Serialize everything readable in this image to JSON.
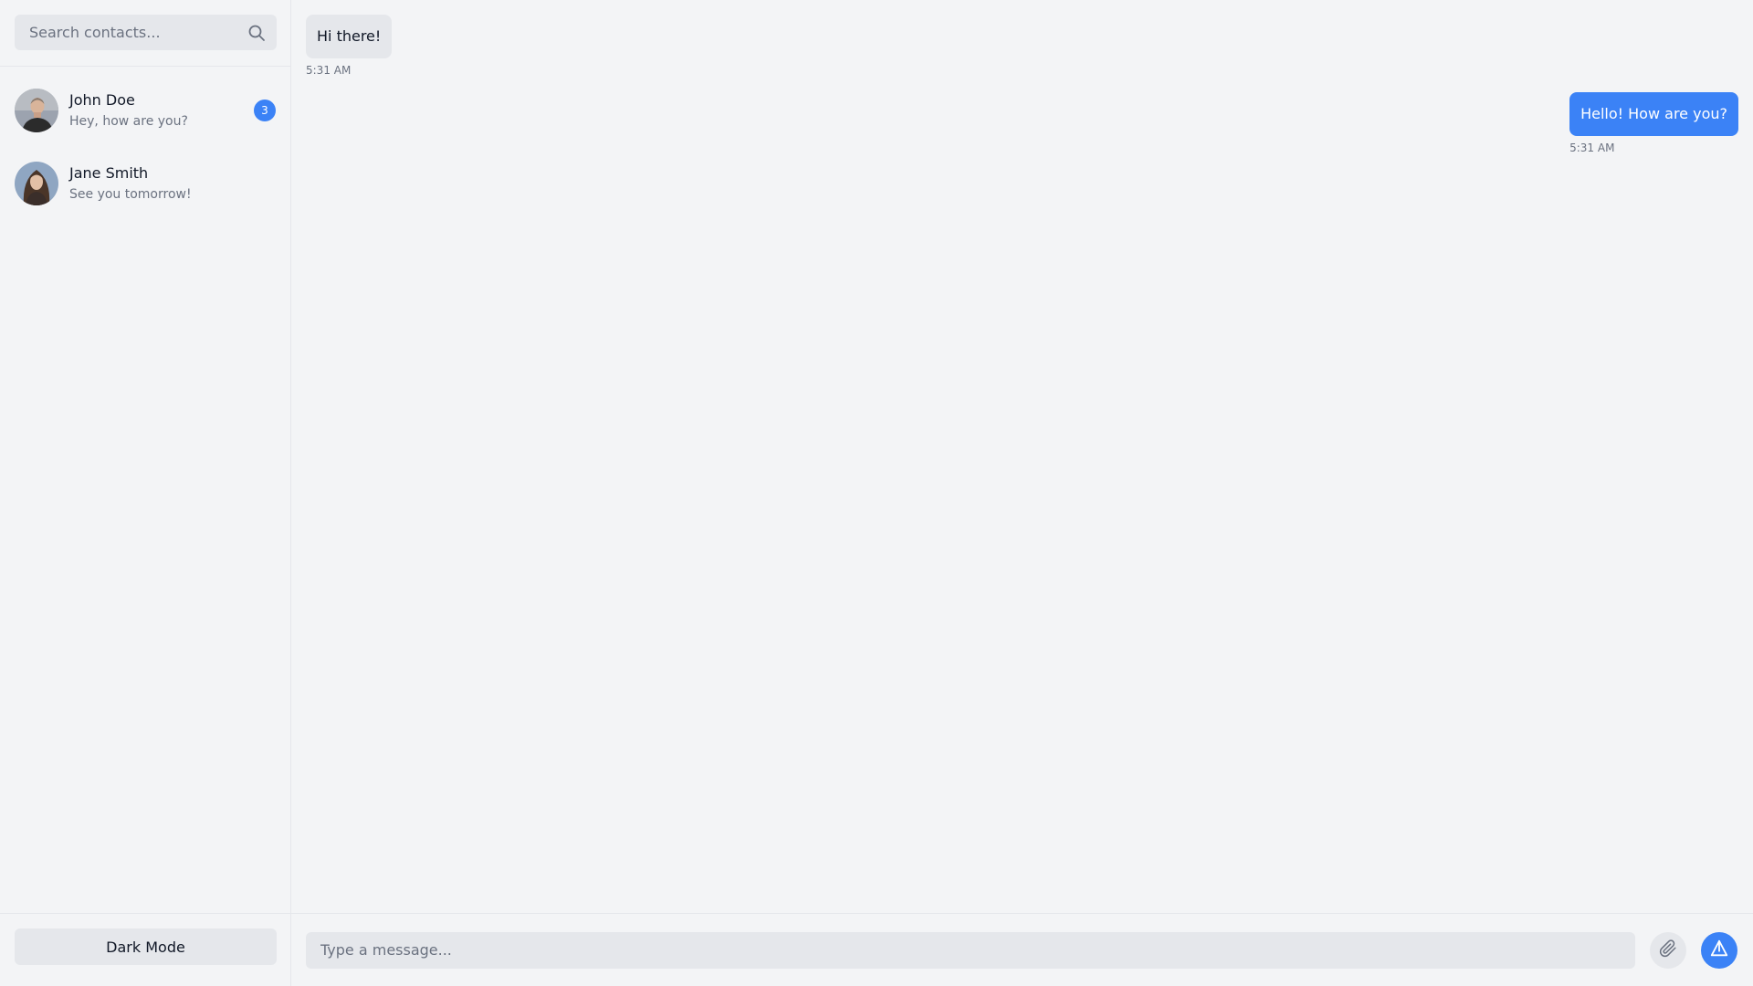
{
  "search": {
    "placeholder": "Search contacts...",
    "icon": "search-icon"
  },
  "contacts": [
    {
      "name": "John Doe",
      "preview": "Hey, how are you?",
      "unread": "3",
      "avatar": "avatar-photo-man"
    },
    {
      "name": "Jane Smith",
      "preview": "See you tomorrow!",
      "avatar": "avatar-photo-woman"
    }
  ],
  "sidebar_footer": {
    "dark_mode_label": "Dark Mode"
  },
  "messages": [
    {
      "direction": "incoming",
      "text": "Hi there!",
      "time": "5:31 AM"
    },
    {
      "direction": "outgoing",
      "text": "Hello! How are you?",
      "time": "5:31 AM"
    }
  ],
  "composer": {
    "placeholder": "Type a message...",
    "attach_icon": "paperclip-icon",
    "send_icon": "send-icon"
  },
  "colors": {
    "accent": "#3b82f6",
    "background": "#f3f4f6",
    "surface": "#e5e7eb",
    "muted_text": "#6b7280"
  }
}
